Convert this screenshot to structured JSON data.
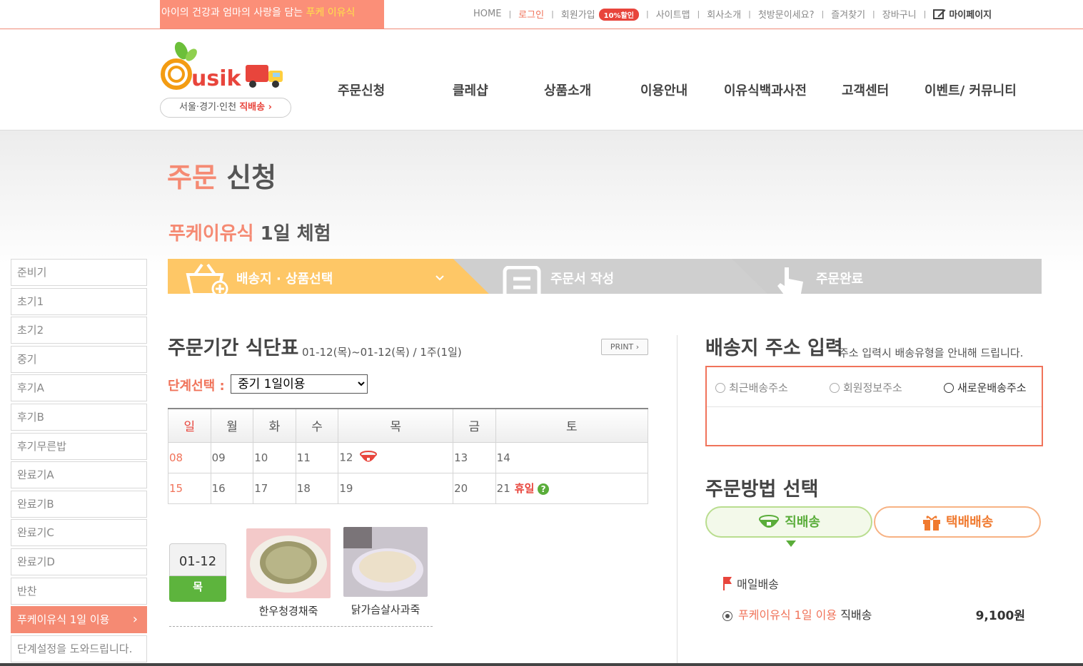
{
  "topbar": {
    "tagline_prefix": "아이의 건강과 엄마의 사랑을 담는 ",
    "tagline_brand": "푸케 이유식",
    "links": {
      "home": "HOME",
      "login": "로그인",
      "signup": "회원가입",
      "signup_badge": "10%할인",
      "sitemap": "사이트맵",
      "company": "회사소개",
      "first_visit": "첫방문이세요?",
      "bookmark": "즐겨찾기",
      "cart": "장바구니",
      "mypage": "마이페이지"
    }
  },
  "header": {
    "logo_text": "usik",
    "region_text": "서울·경기·인천 ",
    "region_link": "직배송",
    "nav": [
      "주문신청",
      "클레샵",
      "상품소개",
      "이용안내",
      "이유식백과사전",
      "고객센터",
      "이벤트/ 커뮤니티"
    ]
  },
  "page": {
    "title_accent": "주문",
    "title_rest": " 신청",
    "subtitle_accent": "푸케이유식",
    "subtitle_rest": " 1일 체험"
  },
  "sidebar": {
    "items": [
      "준비기",
      "초기1",
      "초기2",
      "중기",
      "후기A",
      "후기B",
      "후기무른밥",
      "완료기A",
      "완료기B",
      "완료기C",
      "완료기D",
      "반찬",
      "푸케이유식 1일 이용",
      "단계설정을 도와드립니다."
    ]
  },
  "steps": {
    "step1": "배송지 · 상품선택",
    "step2": "주문서 작성",
    "step3": "주문완료"
  },
  "calendar": {
    "title": "주문기간 식단표",
    "period": "01-12(목)~01-12(목) / 1주(1일)",
    "print": "PRINT",
    "stage_label": "단계선택 :",
    "stage_value": "중기 1일이용",
    "weekdays": [
      "일",
      "월",
      "화",
      "수",
      "목",
      "금",
      "토"
    ],
    "week1": [
      "08",
      "09",
      "10",
      "11",
      "12",
      "13",
      "14"
    ],
    "week2": [
      "15",
      "16",
      "17",
      "18",
      "19",
      "20",
      "21"
    ],
    "holiday": "휴일",
    "help": "?"
  },
  "menu": {
    "date": "01-12",
    "day": "목",
    "products": [
      "한우청경채죽",
      "닭가슴살사과죽"
    ]
  },
  "address": {
    "title": "배송지 주소 입력",
    "note": "주소 입력시 배송유형을 안내해 드립니다.",
    "options": [
      "최근배송주소",
      "회원정보주소",
      "새로운배송주소"
    ]
  },
  "method": {
    "title": "주문방법 선택",
    "direct": "직배송",
    "parcel": "택배배송",
    "daily": "매일배송",
    "option_name": "푸케이유식 1일 이용",
    "option_type": " 직배송",
    "price": "9,100원"
  },
  "colors": {
    "accent": "#f58a73",
    "step_active": "#fec766",
    "green": "#5aad3a"
  }
}
